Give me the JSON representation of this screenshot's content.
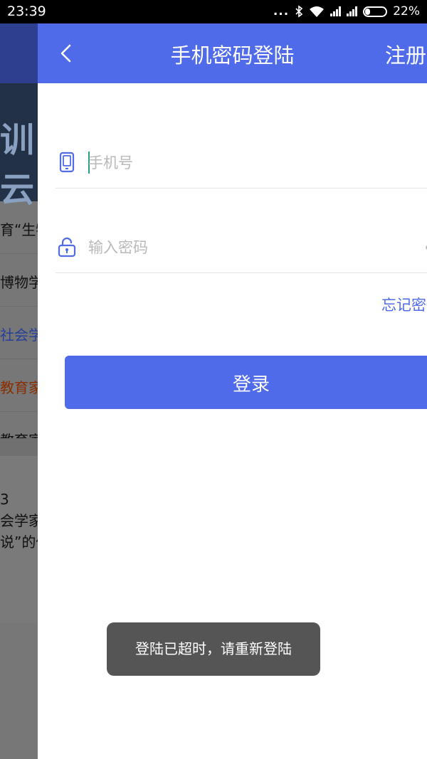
{
  "status_bar": {
    "time": "23:39",
    "dots": "...",
    "battery_percent": "22%",
    "battery_level": 0.22,
    "icons": [
      "bluetooth-icon",
      "wifi-icon",
      "signal-icon",
      "signal-icon",
      "battery-icon"
    ]
  },
  "background": {
    "banner_text": "训云",
    "rows": [
      "育“生物",
      "博物学",
      "社会学",
      "教育家",
      "教育家"
    ],
    "block_lines": [
      "3",
      "会学家和",
      "说”的代"
    ]
  },
  "appbar": {
    "title": "手机密码登陆",
    "register_label": "注册",
    "back_icon": "chevron-left-icon"
  },
  "form": {
    "phone_placeholder": "手机号",
    "phone_value": "",
    "phone_icon": "phone-icon",
    "password_placeholder": "输入密码",
    "password_value": "",
    "password_icon": "lock-icon",
    "forgot_label": "忘记密码"
  },
  "login_button_label": "登录",
  "toast_message": "登陆已超时，请重新登陆",
  "colors": {
    "primary": "#4f6be9",
    "status_bar": "#000000",
    "toast_bg": "#555555"
  }
}
